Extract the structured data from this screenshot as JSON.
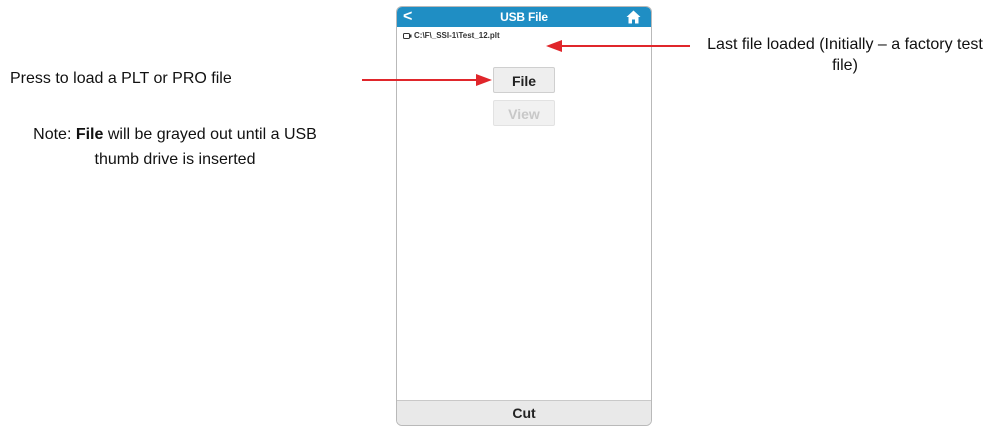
{
  "device": {
    "back_glyph": "<",
    "title": "USB File",
    "path": "C:\\F\\_SSI-1\\Test_12.plt",
    "file_button": "File",
    "view_button": "View",
    "cut_button": "Cut"
  },
  "annotations": {
    "press_label": "Press to load a PLT or PRO file",
    "note_prefix": "Note: ",
    "note_bold": "File",
    "note_rest": " will be grayed out until a USB thumb drive is inserted",
    "last_file": "Last file loaded (Initially – a factory test file)"
  },
  "colors": {
    "titlebar": "#1f8ec4",
    "arrow": "#e0262b",
    "disabled_text": "#c8c8c8"
  }
}
